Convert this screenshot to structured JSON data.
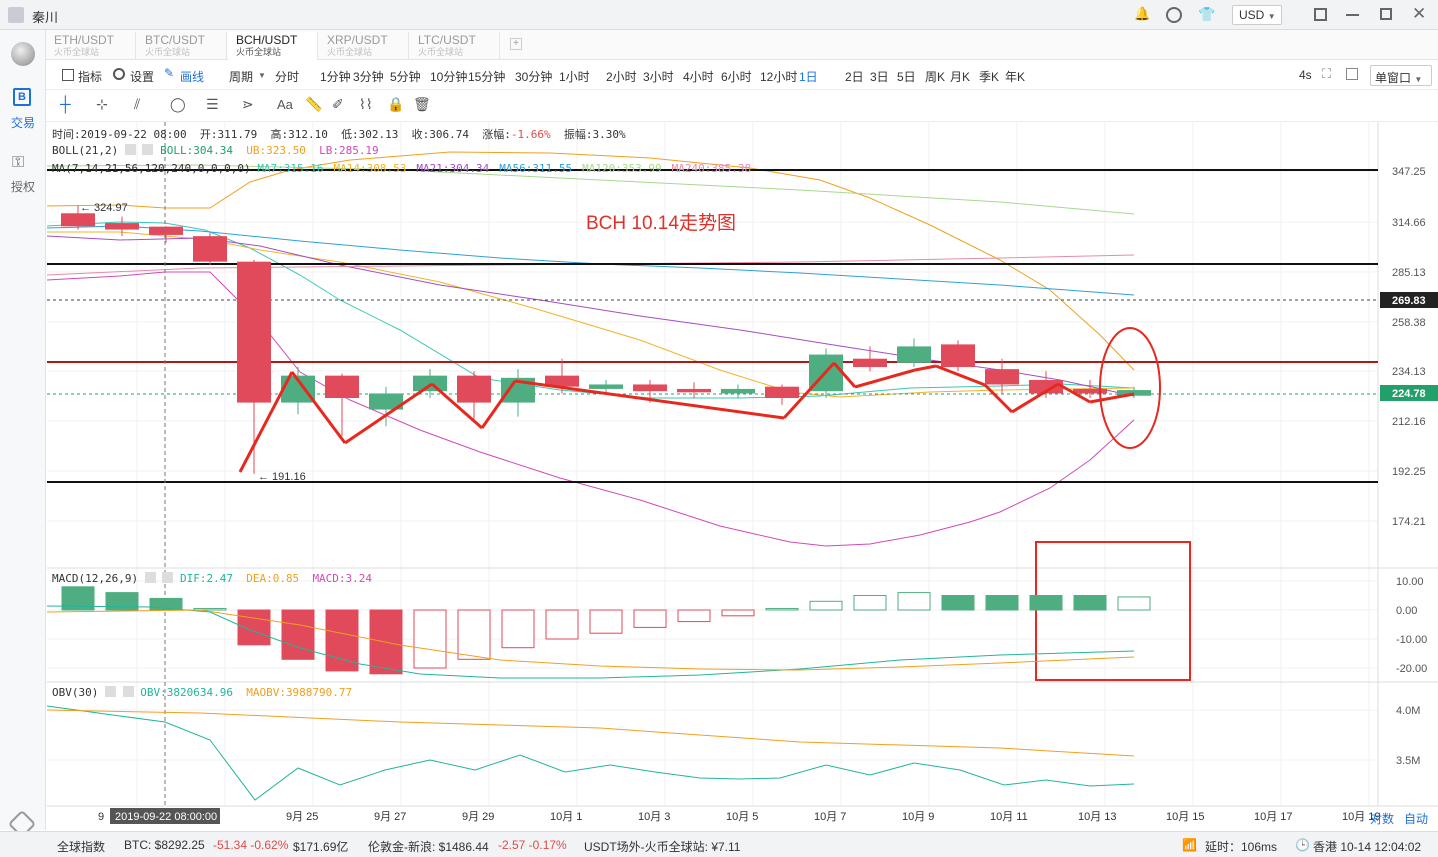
{
  "titlebar": {
    "username": "秦川",
    "currency": "USD"
  },
  "sidebar": {
    "items": [
      {
        "label": "交易"
      },
      {
        "label": "授权"
      }
    ]
  },
  "tabs": [
    {
      "symbol": "ETH/USDT",
      "exchange": "火币全球站",
      "active": false
    },
    {
      "symbol": "BTC/USDT",
      "exchange": "火币全球站",
      "active": false
    },
    {
      "symbol": "BCH/USDT",
      "exchange": "火币全球站",
      "active": true
    },
    {
      "symbol": "XRP/USDT",
      "exchange": "火币全球站",
      "active": false
    },
    {
      "symbol": "LTC/USDT",
      "exchange": "火币全球站",
      "active": false
    }
  ],
  "toolbar": {
    "indicator": "指标",
    "settings": "设置",
    "draw": "画线",
    "period_label": "周期",
    "periods": [
      "分时",
      "1分钟",
      "3分钟",
      "5分钟",
      "10分钟",
      "15分钟",
      "30分钟",
      "1小时",
      "2小时",
      "3小时",
      "4小时",
      "6小时",
      "12小时",
      "1日",
      "2日",
      "3日",
      "5日",
      "周K",
      "月K",
      "季K",
      "年K"
    ],
    "active_period": "1日",
    "refresh": "4s",
    "window_mode": "单窗口"
  },
  "drawtools": {
    "text_tool": "Aa"
  },
  "chart_data": {
    "type": "candlestick",
    "title": "BCH  10.14走势图",
    "info": {
      "time_label": "时间:2019-09-22 08:00",
      "open": "开:311.79",
      "high": "高:312.10",
      "low": "低:302.13",
      "close": "收:306.74",
      "change_label": "涨幅:",
      "change": "-1.66%",
      "amplitude": "振幅:3.30%"
    },
    "boll": {
      "name": "BOLL(21,2)",
      "boll": "BOLL:304.34",
      "ub": "UB:323.50",
      "lb": "LB:285.19"
    },
    "ma": {
      "name": "MA(7,14,21,56,120,240,0,0,0,0)",
      "values": [
        {
          "label": "MA7:315.16",
          "color": "#3cc6b3"
        },
        {
          "label": "MA14:308.53",
          "color": "#f0b42a"
        },
        {
          "label": "MA21:304.34",
          "color": "#a24ec4"
        },
        {
          "label": "MA56:311.55",
          "color": "#2ea0d8"
        },
        {
          "label": "MA120:353.99",
          "color": "#a8d890"
        },
        {
          "label": "MA240:385.38",
          "color": "#e88aa8"
        }
      ]
    },
    "price_axis": [
      "347.25",
      "314.66",
      "285.13",
      "258.38",
      "234.13",
      "212.16",
      "192.25",
      "174.21"
    ],
    "price_markers": [
      {
        "label": "269.83",
        "color": "#333333"
      },
      {
        "label": "224.78",
        "color": "#22a06b"
      }
    ],
    "annotations": {
      "high_marker": "← 324.97",
      "low_marker": "← 191.16",
      "crosshair_time": "2019-09-22 08:00:00"
    },
    "x_axis": [
      "9",
      "9月 25",
      "9月 27",
      "9月 29",
      "10月 1",
      "10月 3",
      "10月 5",
      "10月 7",
      "10月 9",
      "10月 11",
      "10月 13",
      "10月 15",
      "10月 17",
      "10月 19"
    ],
    "candles": [
      {
        "o": 320.0,
        "c": 312.0,
        "h": 324.97,
        "l": 310.0
      },
      {
        "o": 314.0,
        "c": 310.0,
        "h": 318.0,
        "l": 306.0
      },
      {
        "o": 311.79,
        "c": 306.74,
        "h": 312.1,
        "l": 302.13
      },
      {
        "o": 306.0,
        "c": 291.0,
        "h": 308.0,
        "l": 289.0
      },
      {
        "o": 291.0,
        "c": 220.0,
        "h": 292.0,
        "l": 191.16
      },
      {
        "o": 220.0,
        "c": 232.0,
        "h": 236.0,
        "l": 215.0
      },
      {
        "o": 232.0,
        "c": 222.0,
        "h": 233.0,
        "l": 206.0
      },
      {
        "o": 217.0,
        "c": 224.0,
        "h": 227.0,
        "l": 210.0
      },
      {
        "o": 225.0,
        "c": 232.0,
        "h": 235.0,
        "l": 222.0
      },
      {
        "o": 232.0,
        "c": 220.0,
        "h": 234.0,
        "l": 212.0
      },
      {
        "o": 220.0,
        "c": 231.0,
        "h": 235.0,
        "l": 214.0
      },
      {
        "o": 232.0,
        "c": 227.0,
        "h": 240.0,
        "l": 224.0
      },
      {
        "o": 226.0,
        "c": 228.0,
        "h": 230.0,
        "l": 224.0
      },
      {
        "o": 228.0,
        "c": 225.0,
        "h": 230.0,
        "l": 220.0
      },
      {
        "o": 226.0,
        "c": 224.5,
        "h": 229.0,
        "l": 222.0
      },
      {
        "o": 224.0,
        "c": 226.0,
        "h": 228.0,
        "l": 222.0
      },
      {
        "o": 227.0,
        "c": 222.0,
        "h": 228.0,
        "l": 219.0
      },
      {
        "o": 225.0,
        "c": 242.0,
        "h": 245.0,
        "l": 222.0
      },
      {
        "o": 240.0,
        "c": 236.0,
        "h": 246.0,
        "l": 234.0
      },
      {
        "o": 238.0,
        "c": 246.0,
        "h": 250.0,
        "l": 236.0
      },
      {
        "o": 247.0,
        "c": 236.0,
        "h": 249.0,
        "l": 234.0
      },
      {
        "o": 235.0,
        "c": 228.0,
        "h": 240.0,
        "l": 224.0
      },
      {
        "o": 230.0,
        "c": 224.0,
        "h": 234.0,
        "l": 222.0
      },
      {
        "o": 226.0,
        "c": 224.0,
        "h": 230.0,
        "l": 222.0
      },
      {
        "o": 223.0,
        "c": 225.5,
        "h": 227.0,
        "l": 222.0
      }
    ],
    "macd": {
      "name": "MACD(12,26,9)",
      "dif": "DIF:2.47",
      "dea": "DEA:0.85",
      "macd": "MACD:3.24",
      "axis": [
        "10.00",
        "0.00",
        "-10.00",
        "-20.00"
      ],
      "hist": [
        8,
        6,
        4,
        0.5,
        -12,
        -17,
        -21,
        -22,
        -20,
        -17,
        -13,
        -10,
        -8,
        -6,
        -4,
        -2,
        0.5,
        3,
        5,
        6,
        5,
        5,
        5,
        5,
        4.5
      ]
    },
    "obv": {
      "name": "OBV(30)",
      "obv": "OBV:3820634.96",
      "maobv": "MAOBV:3988790.77",
      "axis": [
        "4.0M",
        "3.5M"
      ]
    }
  },
  "statusbar": {
    "index_label": "全球指数",
    "btc": "BTC:  $8292.25",
    "btc_change": "-51.34 -0.62%",
    "btc_vol": "$171.69亿",
    "gold": "伦敦金-新浪:  $1486.44",
    "gold_change": "-2.57 -0.17%",
    "usdt": "USDT场外-火币全球站:  ¥7.11",
    "latency": "延时：106ms",
    "clock": "香港 10-14 12:04:02",
    "time_mode": "对数",
    "auto": "自动"
  }
}
